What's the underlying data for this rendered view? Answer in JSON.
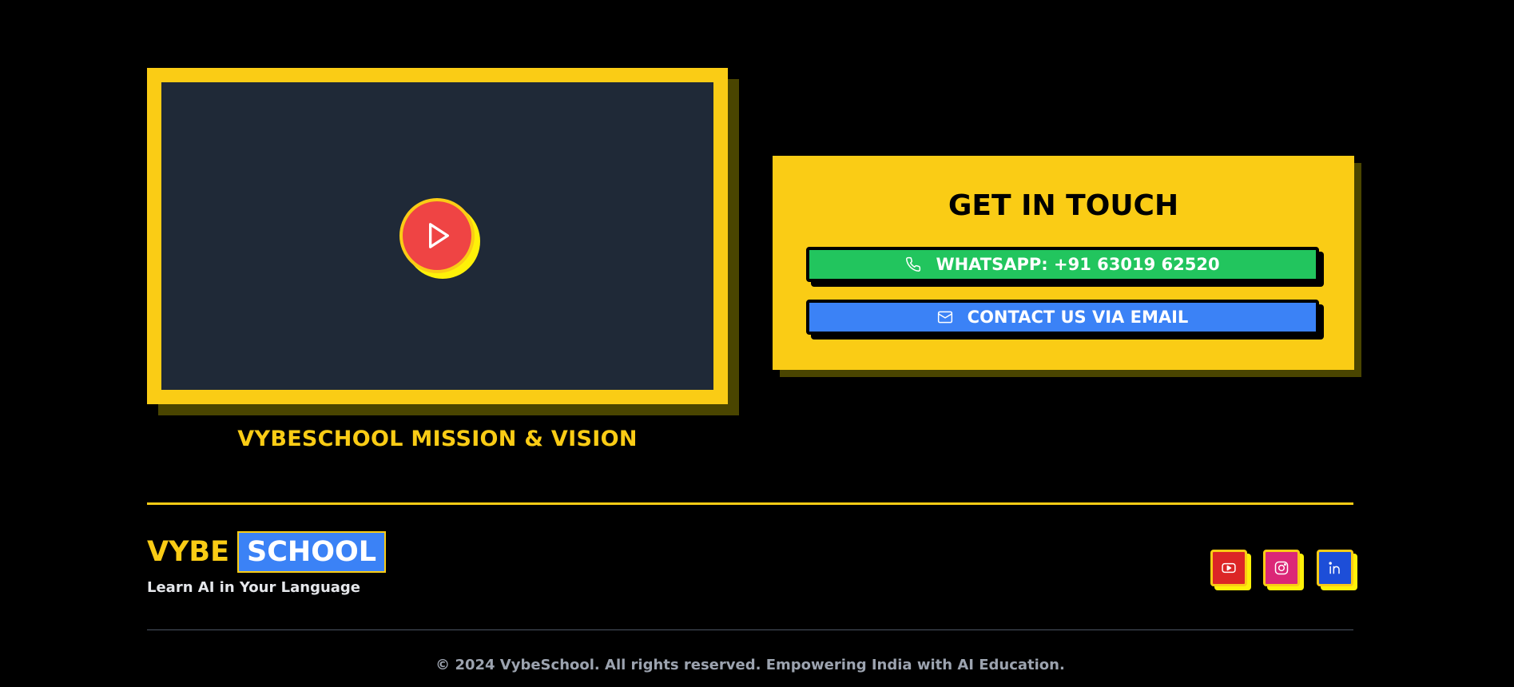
{
  "video": {
    "caption": "VYBESCHOOL MISSION & VISION",
    "play_icon": "play-icon"
  },
  "contact": {
    "title": "GET IN TOUCH",
    "whatsapp_label": "WHATSAPP: +91 63019 62520",
    "whatsapp_icon": "phone-icon",
    "email_label": "CONTACT US VIA EMAIL",
    "email_icon": "mail-icon"
  },
  "brand": {
    "part1": "VYBE",
    "part2": "SCHOOL",
    "tagline": "Learn AI in Your Language"
  },
  "social": [
    {
      "name": "youtube",
      "icon": "youtube-icon"
    },
    {
      "name": "instagram",
      "icon": "instagram-icon"
    },
    {
      "name": "linkedin",
      "icon": "linkedin-icon"
    }
  ],
  "footer": {
    "copyright": "© 2024 VybeSchool. All rights reserved. Empowering India with AI Education."
  },
  "colors": {
    "accent_yellow": "#facc15",
    "video_bg": "#1f2937",
    "play_red": "#ef4444",
    "whatsapp_green": "#22c55e",
    "email_blue": "#3b82f6",
    "youtube_red": "#dc2626",
    "instagram_pink": "#db2777",
    "linkedin_blue": "#1d4ed8"
  }
}
